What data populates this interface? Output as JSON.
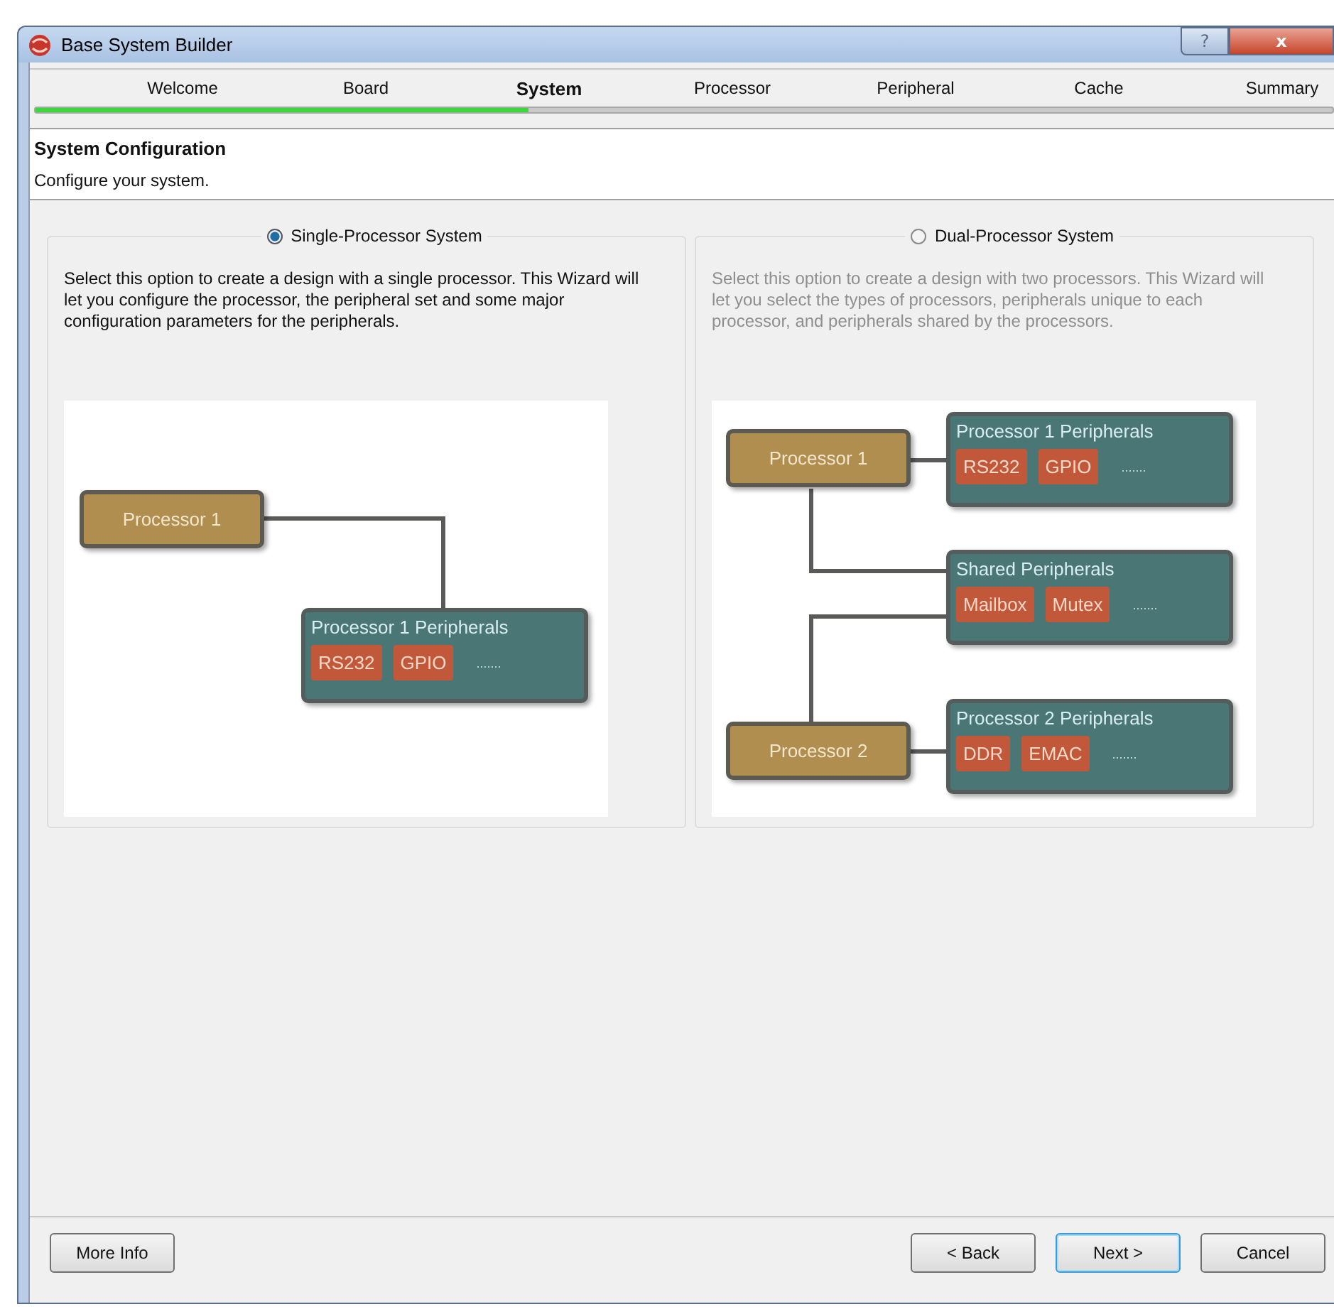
{
  "window": {
    "title": "Base System Builder",
    "controls": [
      {
        "kind": "help",
        "label": "?"
      },
      {
        "kind": "close",
        "label": "x"
      }
    ]
  },
  "steps": [
    {
      "label": "Welcome",
      "selected": false
    },
    {
      "label": "Board",
      "selected": false
    },
    {
      "label": "System",
      "selected": true
    },
    {
      "label": "Processor",
      "selected": false
    },
    {
      "label": "Peripheral",
      "selected": false
    },
    {
      "label": "Cache",
      "selected": false
    },
    {
      "label": "Summary",
      "selected": false
    }
  ],
  "progress": {
    "level": 0.38
  },
  "header": {
    "title": "System Configuration",
    "subtitle": "Configure your system."
  },
  "options": [
    {
      "label": "Single-Processor System",
      "selected": true,
      "description": "Select this option to create a design with a single processor. This Wizard will let you configure the processor, the peripheral set and some major configuration parameters for the peripherals.",
      "diagram": {
        "kind": "single",
        "processors": [
          "Processor 1"
        ],
        "groups": [
          {
            "title": "Processor 1 Peripherals",
            "chips": [
              "RS232",
              "GPIO"
            ],
            "more": "......."
          }
        ]
      }
    },
    {
      "label": "Dual-Processor System",
      "selected": false,
      "description": "Select this option to create a design with two processors. This Wizard will let you select the types of processors, peripherals unique to each processor, and peripherals shared by the processors.",
      "diagram": {
        "kind": "dual",
        "processors": [
          "Processor 1",
          "Processor 2"
        ],
        "groups": [
          {
            "title": "Processor 1 Peripherals",
            "chips": [
              "RS232",
              "GPIO"
            ],
            "more": "......."
          },
          {
            "title": "Shared Peripherals",
            "chips": [
              "Mailbox",
              "Mutex"
            ],
            "more": "......."
          },
          {
            "title": "Processor 2 Peripherals",
            "chips": [
              "DDR",
              "EMAC"
            ],
            "more": "......."
          }
        ]
      }
    }
  ],
  "footer": {
    "left_buttons": [
      {
        "label": "More Info",
        "focused": false
      }
    ],
    "right_buttons": [
      {
        "label": "< Back",
        "focused": false
      },
      {
        "label": "Next >",
        "focused": true
      },
      {
        "label": "Cancel",
        "focused": false
      }
    ]
  }
}
